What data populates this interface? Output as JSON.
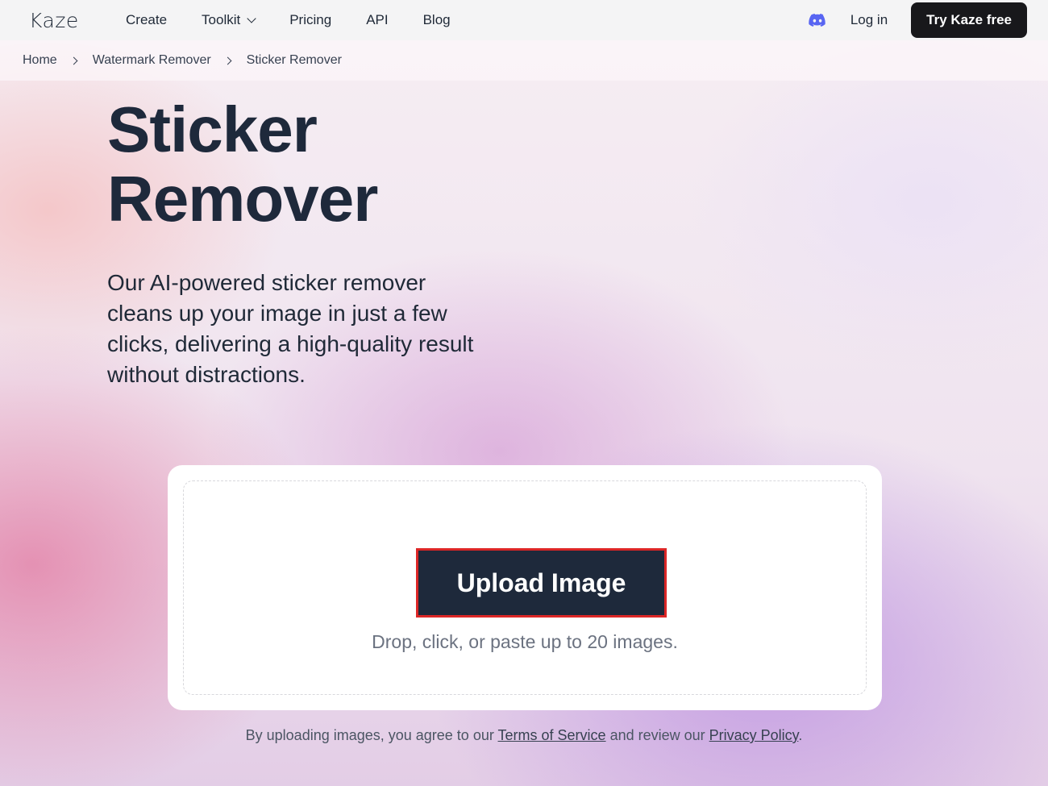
{
  "nav": {
    "logo": "Kaze",
    "links": [
      "Create",
      "Toolkit",
      "Pricing",
      "API",
      "Blog"
    ],
    "login": "Log in",
    "cta": "Try Kaze free",
    "discord_color": "#5865F2"
  },
  "breadcrumb": [
    "Home",
    "Watermark Remover",
    "Sticker Remover"
  ],
  "hero": {
    "title": "Sticker\nRemover",
    "description": "Our AI-powered sticker remover cleans up your image in just a few clicks, delivering a high-quality result without distractions."
  },
  "upload": {
    "button": "Upload Image",
    "hint": "Drop, click, or paste up to 20 images."
  },
  "legal": {
    "prefix": "By uploading images, you agree to our ",
    "terms": "Terms of Service",
    "middle": " and review our ",
    "privacy": "Privacy Policy",
    "suffix": "."
  }
}
